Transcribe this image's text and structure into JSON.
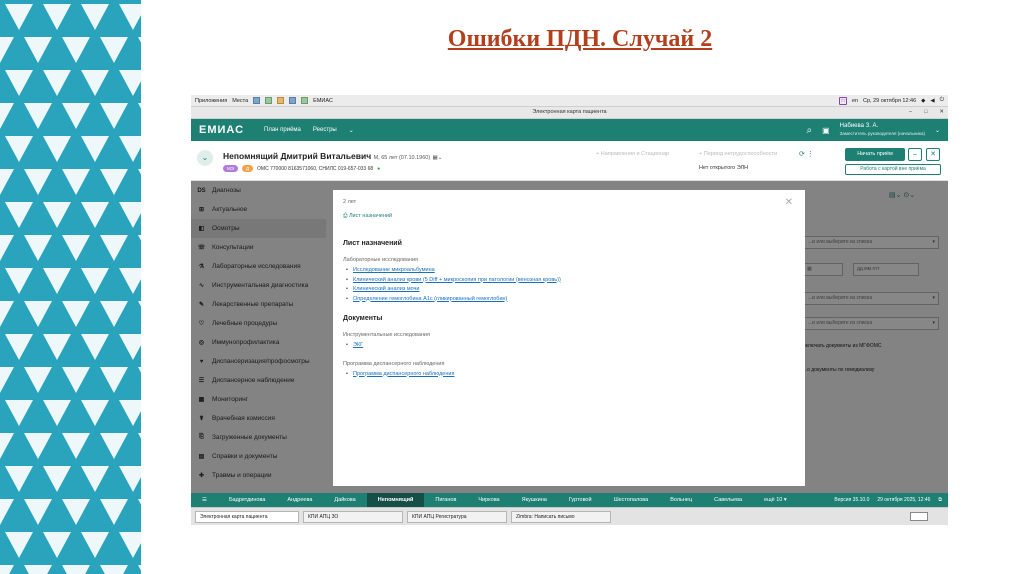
{
  "slide": {
    "title": "Ошибки ПДН. Случай 2"
  },
  "system_bar": {
    "apps": "Приложения",
    "places": "Места",
    "app_name": "ЕМИАС",
    "lang": "en",
    "datetime": "Ср, 29 октября 12:46"
  },
  "window": {
    "title": "Электронная карта пациента"
  },
  "app_header": {
    "logo": "ЕМИАС",
    "menu_plan": "План приёма",
    "menu_registries": "Реестры",
    "user_name": "Набиева З. А.",
    "user_role": "Заместитель руководителя (начальника)"
  },
  "patient": {
    "name": "Непомнящий Дмитрий Витальевич",
    "meta": "М, 65 лет (07.10.1960)",
    "badge1": "МЭ",
    "badge2": "Д",
    "oms_snils": "ОМС 770000 8163571060, СНИЛС 019-657-033 68",
    "directions": "+ Направления и Стационар",
    "disability": "+ Период нетрудоспособности",
    "no_eln": "Нет открытого ЭЛН",
    "start_button": "Начать приём",
    "offline_button": "Работа с картой вне приёма"
  },
  "sidebar": {
    "items": [
      {
        "icon": "DS",
        "label": "Диагнозы"
      },
      {
        "icon": "⊞",
        "label": "Актуальное"
      },
      {
        "icon": "◧",
        "label": "Осмотры"
      },
      {
        "icon": "☏",
        "label": "Консультации"
      },
      {
        "icon": "⚗",
        "label": "Лабораторные исследования"
      },
      {
        "icon": "∿",
        "label": "Инструментальная диагностика"
      },
      {
        "icon": "✎",
        "label": "Лекарственные препараты"
      },
      {
        "icon": "♡",
        "label": "Лечебные процедуры"
      },
      {
        "icon": "◎",
        "label": "Иммунопрофилактика"
      },
      {
        "icon": "♥",
        "label": "Диспансеризация/профосмотры"
      },
      {
        "icon": "☰",
        "label": "Диспансерное наблюдение"
      },
      {
        "icon": "▦",
        "label": "Мониторинг"
      },
      {
        "icon": "☤",
        "label": "Врачебная комиссия"
      },
      {
        "icon": "⎘",
        "label": "Загруженные документы"
      },
      {
        "icon": "▤",
        "label": "Справки и документы"
      },
      {
        "icon": "✚",
        "label": "Травмы и операции"
      }
    ]
  },
  "right_panel": {
    "select1": "...и или выберите из списка",
    "date_to": "дд.мм.гггг",
    "select2": "...и или выберите из списка",
    "select3": "...и или выберите из списка",
    "checkbox1": "включать документы из МГФОМС",
    "checkbox2": "...о документы по гемодиализу"
  },
  "modal": {
    "year": "2 лет",
    "tab": "Лист назначений",
    "heading": "Лист назначений",
    "lab_category": "Лабораторные исследования",
    "lab_items": [
      "Исследование микроальбумина",
      "Клинический анализ крови (5 Diff + микроскопия при патологии (венозная кровь))",
      "Клинический анализ мочи",
      "Определение гемоглобина A1c (гликированный гемоглобин)"
    ],
    "docs_heading": "Документы",
    "instr_category": "Инструментальные исследования",
    "instr_items": [
      "ЭКГ"
    ],
    "program_category": "Программа диспансерного наблюдения",
    "program_items": [
      "Программа диспансерного наблюдения"
    ]
  },
  "taskbar": {
    "patients": [
      "Бадретдинова",
      "Андреева",
      "Дайкова",
      "Непомнящий",
      "Пиганов",
      "Чиркова",
      "Якушкина",
      "Гуртовой",
      "Шестопалова",
      "Вольнец",
      "Савельева",
      "ещё 10 ▾"
    ],
    "version": "Версия 35.10.0",
    "datetime": "29 октября 2025, 12:46"
  },
  "windows_bar": {
    "items": [
      "Электронная карта пациента",
      "КПИ АПЦ ЗО",
      "КПИ АПЦ Регистратура",
      "Zimbra: Написать письмо"
    ]
  }
}
